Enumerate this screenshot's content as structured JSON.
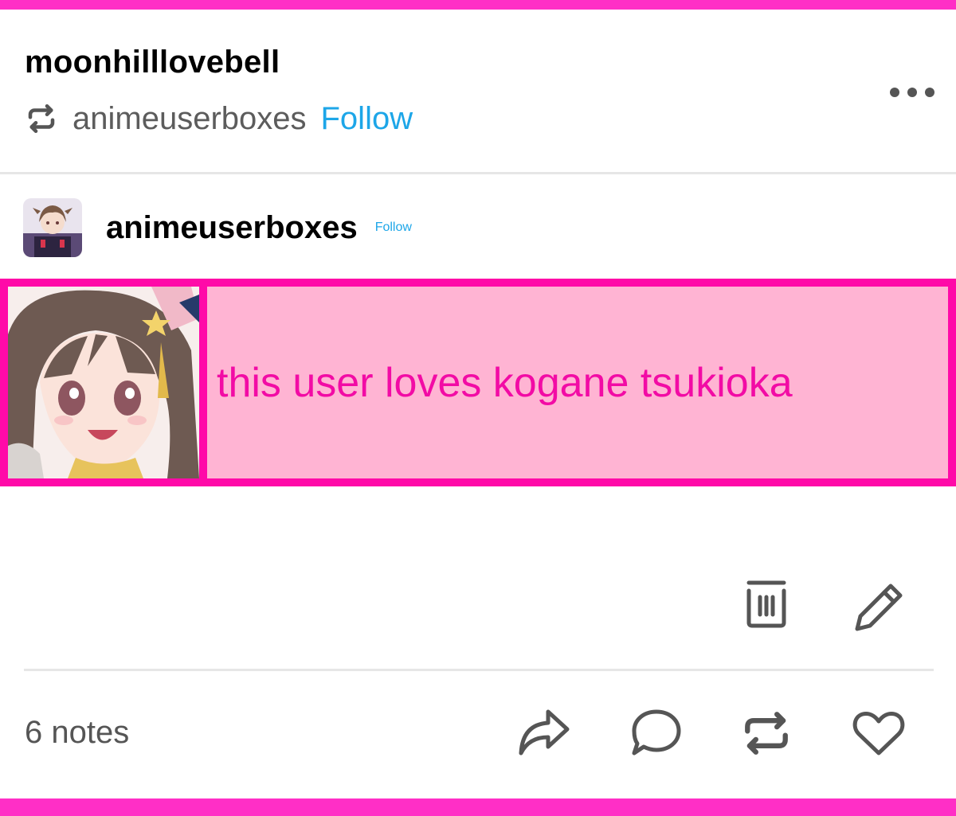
{
  "post": {
    "username": "moonhilllovebell",
    "reblogged_from": "animeuserboxes",
    "reblog_follow_label": "Follow",
    "author": "animeuserboxes",
    "author_follow_label": "Follow",
    "userbox_text": "this user loves kogane tsukioka",
    "notes_text": "6 notes"
  },
  "icons": {
    "reblog_indicator": "reblog-icon",
    "more": "more-options-icon",
    "delete": "trash-icon",
    "edit": "pencil-icon",
    "share": "share-arrow-icon",
    "reply": "speech-bubble-icon",
    "reblog": "reblog-icon",
    "like": "heart-icon"
  },
  "colors": {
    "frame": "#ff2fc6",
    "follow": "#1da6e8",
    "userbox_border": "#ff0aa8",
    "userbox_fill": "#ffb4d3",
    "userbox_text": "#f20ba5"
  }
}
